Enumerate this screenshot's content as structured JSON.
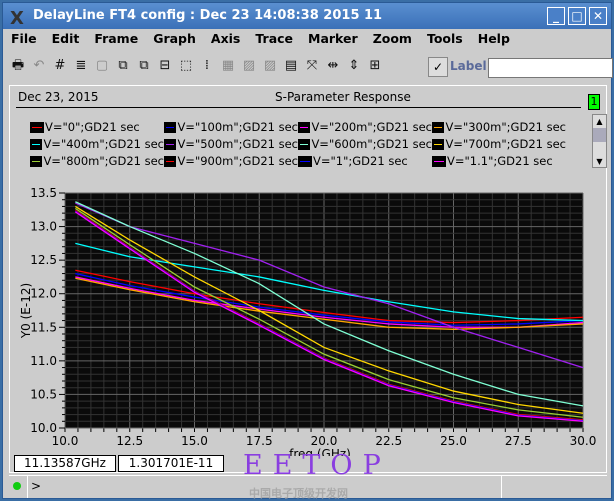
{
  "window": {
    "title": "DelayLine FT4 config : Dec 23 14:08:38 2015 11",
    "minimize": "_",
    "maximize": "□",
    "close": "✕"
  },
  "menu": [
    "File",
    "Edit",
    "Frame",
    "Graph",
    "Axis",
    "Trace",
    "Marker",
    "Zoom",
    "Tools",
    "Help"
  ],
  "toolbar": {
    "icons": [
      {
        "name": "print-icon",
        "g": "🖶",
        "d": false
      },
      {
        "name": "undo-icon",
        "g": "↶",
        "d": true
      },
      {
        "name": "grid-icon",
        "g": "#",
        "d": false
      },
      {
        "name": "lines-icon",
        "g": "≣",
        "d": false
      },
      {
        "name": "frame-icon",
        "g": "▢",
        "d": true
      },
      {
        "name": "split-icon",
        "g": "⧉",
        "d": false
      },
      {
        "name": "copy-icon",
        "g": "⧉",
        "d": false
      },
      {
        "name": "stack-icon",
        "g": "⊟",
        "d": false
      },
      {
        "name": "resize-icon",
        "g": "⬚",
        "d": false
      },
      {
        "name": "legend-icon",
        "g": "⁞",
        "d": false
      },
      {
        "name": "table-icon",
        "g": "▦",
        "d": true
      },
      {
        "name": "wave-icon",
        "g": "▨",
        "d": true
      },
      {
        "name": "wave2-icon",
        "g": "▨",
        "d": true
      },
      {
        "name": "calculator-icon",
        "g": "▤",
        "d": false
      },
      {
        "name": "zoom-fit-icon",
        "g": "⤧",
        "d": false
      },
      {
        "name": "zoom-x-icon",
        "g": "⇹",
        "d": false
      },
      {
        "name": "zoom-y-icon",
        "g": "⇕",
        "d": false
      },
      {
        "name": "zoom-in-icon",
        "g": "⊞",
        "d": false
      }
    ],
    "checkbox": "✓",
    "label": "Label",
    "label_value": ""
  },
  "graph": {
    "date": "Dec 23, 2015",
    "title": "S-Parameter Response",
    "page": "1"
  },
  "chart_data": {
    "type": "line",
    "xlabel": "freq (GHz)",
    "ylabel": "Y0 (E-12)",
    "xlim": [
      10,
      30
    ],
    "ylim": [
      10,
      13.5
    ],
    "xticks": [
      "10.0",
      "12.5",
      "15.0",
      "17.5",
      "20.0",
      "22.5",
      "25.0",
      "27.5",
      "30.0"
    ],
    "yticks": [
      "10.0",
      "10.5",
      "11.0",
      "11.5",
      "12.0",
      "12.5",
      "13.0",
      "13.5"
    ],
    "x": [
      10.4,
      12.5,
      15,
      17.5,
      20,
      22.5,
      25,
      27.5,
      30
    ],
    "series": [
      {
        "name": "V=\"0\";GD21 sec",
        "color": "#ff0000",
        "values": [
          12.35,
          12.18,
          12.0,
          11.85,
          11.72,
          11.6,
          11.57,
          11.6,
          11.65
        ]
      },
      {
        "name": "V=\"100m\";GD21 sec",
        "color": "#0000ff",
        "values": [
          12.3,
          12.12,
          11.95,
          11.8,
          11.68,
          11.58,
          11.53,
          11.55,
          11.6
        ]
      },
      {
        "name": "V=\"200m\";GD21 sec",
        "color": "#ff00ff",
        "values": [
          12.25,
          12.08,
          11.9,
          11.77,
          11.65,
          11.55,
          11.5,
          11.5,
          11.57
        ]
      },
      {
        "name": "V=\"300m\";GD21 sec",
        "color": "#ffa500",
        "values": [
          12.23,
          12.06,
          11.88,
          11.74,
          11.62,
          11.5,
          11.47,
          11.5,
          11.55
        ]
      },
      {
        "name": "V=\"400m\";GD21 sec",
        "color": "#00ffff",
        "values": [
          12.75,
          12.55,
          12.4,
          12.25,
          12.05,
          11.88,
          11.73,
          11.63,
          11.6
        ]
      },
      {
        "name": "V=\"500m\";GD21 sec",
        "color": "#a020f0",
        "values": [
          13.35,
          13.0,
          12.75,
          12.5,
          12.1,
          11.85,
          11.5,
          11.2,
          10.9
        ]
      },
      {
        "name": "V=\"600m\";GD21 sec",
        "color": "#7fffd4",
        "values": [
          13.37,
          13.0,
          12.6,
          12.15,
          11.55,
          11.15,
          10.8,
          10.5,
          10.33
        ]
      },
      {
        "name": "V=\"700m\";GD21 sec",
        "color": "#ffd700",
        "values": [
          13.3,
          12.8,
          12.25,
          11.75,
          11.2,
          10.85,
          10.55,
          10.35,
          10.22
        ]
      },
      {
        "name": "V=\"800m\";GD21 sec",
        "color": "#9acd32",
        "values": [
          13.27,
          12.73,
          12.1,
          11.62,
          11.1,
          10.72,
          10.45,
          10.27,
          10.16
        ]
      },
      {
        "name": "V=\"900m\";GD21 sec",
        "color": "#ff0000",
        "values": [
          13.24,
          12.69,
          12.04,
          11.55,
          11.04,
          10.65,
          10.4,
          10.2,
          10.12
        ]
      },
      {
        "name": "V=\"1\";GD21 sec",
        "color": "#0000ff",
        "values": [
          13.23,
          12.68,
          12.03,
          11.54,
          11.03,
          10.64,
          10.39,
          10.19,
          10.11
        ]
      },
      {
        "name": "V=\"1.1\";GD21 sec",
        "color": "#ff00ff",
        "values": [
          13.22,
          12.67,
          12.02,
          11.53,
          11.02,
          10.63,
          10.38,
          10.18,
          10.1
        ]
      }
    ]
  },
  "readout": {
    "x": "11.13587GHz",
    "y": "1.301701E-11"
  },
  "command": {
    "prompt": ">"
  },
  "watermark": {
    "text": "EETOP",
    "sub": "中国电子顶级开发网"
  }
}
